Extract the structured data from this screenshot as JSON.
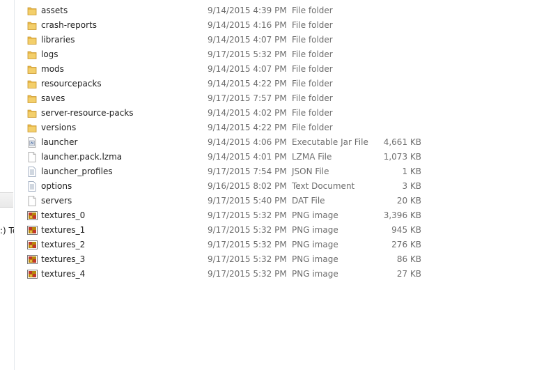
{
  "nav": {
    "clipped_label": ":) Te"
  },
  "files": [
    {
      "name": "assets",
      "date": "9/14/2015 4:39 PM",
      "type": "File folder",
      "size": "",
      "icon": "folder-icon"
    },
    {
      "name": "crash-reports",
      "date": "9/14/2015 4:16 PM",
      "type": "File folder",
      "size": "",
      "icon": "folder-icon"
    },
    {
      "name": "libraries",
      "date": "9/14/2015 4:07 PM",
      "type": "File folder",
      "size": "",
      "icon": "folder-icon"
    },
    {
      "name": "logs",
      "date": "9/17/2015 5:32 PM",
      "type": "File folder",
      "size": "",
      "icon": "folder-icon"
    },
    {
      "name": "mods",
      "date": "9/14/2015 4:07 PM",
      "type": "File folder",
      "size": "",
      "icon": "folder-icon"
    },
    {
      "name": "resourcepacks",
      "date": "9/14/2015 4:22 PM",
      "type": "File folder",
      "size": "",
      "icon": "folder-icon"
    },
    {
      "name": "saves",
      "date": "9/17/2015 7:57 PM",
      "type": "File folder",
      "size": "",
      "icon": "folder-icon"
    },
    {
      "name": "server-resource-packs",
      "date": "9/14/2015 4:02 PM",
      "type": "File folder",
      "size": "",
      "icon": "folder-icon"
    },
    {
      "name": "versions",
      "date": "9/14/2015 4:22 PM",
      "type": "File folder",
      "size": "",
      "icon": "folder-icon"
    },
    {
      "name": "launcher",
      "date": "9/14/2015 4:06 PM",
      "type": "Executable Jar File",
      "size": "4,661 KB",
      "icon": "jar-file-icon"
    },
    {
      "name": "launcher.pack.lzma",
      "date": "9/14/2015 4:01 PM",
      "type": "LZMA File",
      "size": "1,073 KB",
      "icon": "blank-file-icon"
    },
    {
      "name": "launcher_profiles",
      "date": "9/17/2015 7:54 PM",
      "type": "JSON File",
      "size": "1 KB",
      "icon": "text-file-icon"
    },
    {
      "name": "options",
      "date": "9/16/2015 8:02 PM",
      "type": "Text Document",
      "size": "3 KB",
      "icon": "text-file-icon"
    },
    {
      "name": "servers",
      "date": "9/17/2015 5:40 PM",
      "type": "DAT File",
      "size": "20 KB",
      "icon": "blank-file-icon"
    },
    {
      "name": "textures_0",
      "date": "9/17/2015 5:32 PM",
      "type": "PNG image",
      "size": "3,396 KB",
      "icon": "image-file-icon"
    },
    {
      "name": "textures_1",
      "date": "9/17/2015 5:32 PM",
      "type": "PNG image",
      "size": "945 KB",
      "icon": "image-file-icon"
    },
    {
      "name": "textures_2",
      "date": "9/17/2015 5:32 PM",
      "type": "PNG image",
      "size": "276 KB",
      "icon": "image-file-icon"
    },
    {
      "name": "textures_3",
      "date": "9/17/2015 5:32 PM",
      "type": "PNG image",
      "size": "86 KB",
      "icon": "image-file-icon"
    },
    {
      "name": "textures_4",
      "date": "9/17/2015 5:32 PM",
      "type": "PNG image",
      "size": "27 KB",
      "icon": "image-file-icon"
    }
  ],
  "colors": {
    "folder": "#e8b84a",
    "folder_dark": "#c9962c",
    "text_secondary": "#6d6d6d",
    "pane_border": "#e3e7ec"
  }
}
